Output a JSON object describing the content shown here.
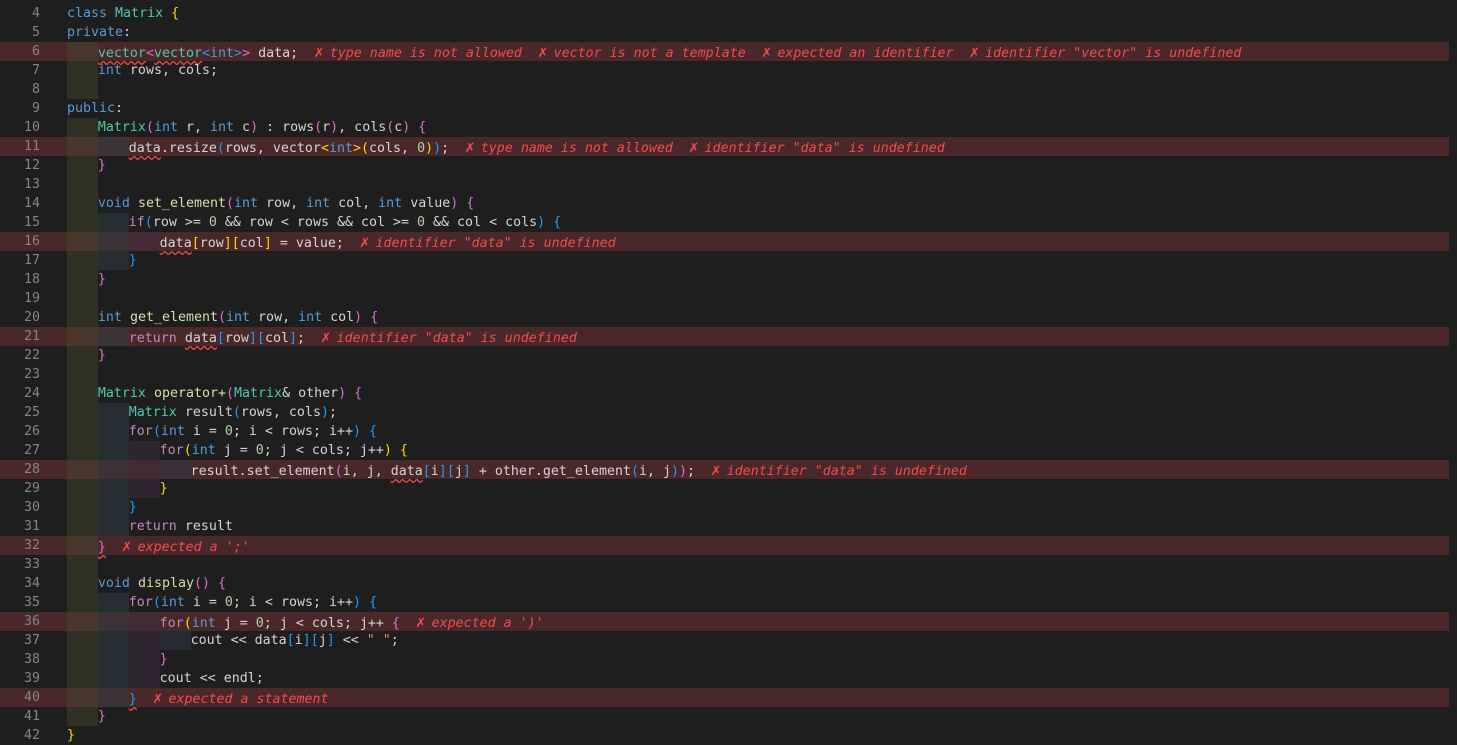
{
  "editor": {
    "colors": {
      "background": "#1e1e1e",
      "error_line": "#4a2829",
      "error_text": "#f14c4c"
    },
    "error_icon": "x-error-icon",
    "lines": [
      {
        "n": "4",
        "indent": 0,
        "tokens": [
          [
            "kw",
            "class"
          ],
          [
            "id",
            " "
          ],
          [
            "ty",
            "Matrix"
          ],
          [
            "id",
            " "
          ],
          [
            "b1",
            "{"
          ]
        ],
        "errors": []
      },
      {
        "n": "5",
        "indent": 0,
        "tokens": [
          [
            "kw",
            "private"
          ],
          [
            "id",
            ":"
          ]
        ],
        "errors": []
      },
      {
        "n": "6",
        "indent": 1,
        "tokens": [
          [
            "ty",
            "vector",
            1
          ],
          [
            "b2",
            "<"
          ],
          [
            "ty",
            "vector",
            1
          ],
          [
            "b3",
            "<"
          ],
          [
            "kw",
            "int"
          ],
          [
            "b3",
            ">"
          ],
          [
            "b2",
            ">"
          ],
          [
            "id",
            " data;"
          ]
        ],
        "errors": [
          "type name is not allowed",
          "vector is not a template",
          "expected an identifier",
          "identifier \"vector\" is undefined"
        ]
      },
      {
        "n": "7",
        "indent": 1,
        "tokens": [
          [
            "kw",
            "int"
          ],
          [
            "id",
            " rows, cols;"
          ]
        ],
        "errors": []
      },
      {
        "n": "8",
        "indent": 1,
        "tokens": [],
        "errors": []
      },
      {
        "n": "9",
        "indent": 0,
        "tokens": [
          [
            "kw",
            "public"
          ],
          [
            "id",
            ":"
          ]
        ],
        "errors": []
      },
      {
        "n": "10",
        "indent": 1,
        "tokens": [
          [
            "ty",
            "Matrix"
          ],
          [
            "b2",
            "("
          ],
          [
            "kw",
            "int"
          ],
          [
            "id",
            " r, "
          ],
          [
            "kw",
            "int"
          ],
          [
            "id",
            " c"
          ],
          [
            "b2",
            ")"
          ],
          [
            "id",
            " : rows"
          ],
          [
            "b2",
            "("
          ],
          [
            "id",
            "r"
          ],
          [
            "b2",
            ")"
          ],
          [
            "id",
            ", cols"
          ],
          [
            "b2",
            "("
          ],
          [
            "id",
            "c"
          ],
          [
            "b2",
            ")"
          ],
          [
            "id",
            " "
          ],
          [
            "b2",
            "{"
          ]
        ],
        "errors": []
      },
      {
        "n": "11",
        "indent": 2,
        "tokens": [
          [
            "id",
            "data",
            1
          ],
          [
            "id",
            ".resize"
          ],
          [
            "b3",
            "("
          ],
          [
            "id",
            "rows, vector"
          ],
          [
            "b1",
            "<"
          ],
          [
            "kw",
            "int"
          ],
          [
            "b1",
            ">"
          ],
          [
            "b1",
            "("
          ],
          [
            "id",
            "cols, "
          ],
          [
            "num",
            "0"
          ],
          [
            "b1",
            ")"
          ],
          [
            "b3",
            ")"
          ],
          [
            "id",
            ";"
          ]
        ],
        "errors": [
          "type name is not allowed",
          "identifier \"data\" is undefined"
        ]
      },
      {
        "n": "12",
        "indent": 1,
        "tokens": [
          [
            "b2",
            "}"
          ]
        ],
        "errors": []
      },
      {
        "n": "13",
        "indent": 1,
        "tokens": [],
        "errors": []
      },
      {
        "n": "14",
        "indent": 1,
        "tokens": [
          [
            "kw",
            "void"
          ],
          [
            "id",
            " "
          ],
          [
            "fn",
            "set_element"
          ],
          [
            "b2",
            "("
          ],
          [
            "kw",
            "int"
          ],
          [
            "id",
            " row, "
          ],
          [
            "kw",
            "int"
          ],
          [
            "id",
            " col, "
          ],
          [
            "kw",
            "int"
          ],
          [
            "id",
            " value"
          ],
          [
            "b2",
            ")"
          ],
          [
            "id",
            " "
          ],
          [
            "b2",
            "{"
          ]
        ],
        "errors": []
      },
      {
        "n": "15",
        "indent": 2,
        "tokens": [
          [
            "kw2",
            "if"
          ],
          [
            "b3",
            "("
          ],
          [
            "id",
            "row >= "
          ],
          [
            "num",
            "0"
          ],
          [
            "id",
            " && row < rows && col >= "
          ],
          [
            "num",
            "0"
          ],
          [
            "id",
            " && col < cols"
          ],
          [
            "b3",
            ")"
          ],
          [
            "id",
            " "
          ],
          [
            "b3",
            "{"
          ]
        ],
        "errors": []
      },
      {
        "n": "16",
        "indent": 3,
        "tokens": [
          [
            "id",
            "data",
            1
          ],
          [
            "b1",
            "["
          ],
          [
            "id",
            "row"
          ],
          [
            "b1",
            "]"
          ],
          [
            "b1",
            "["
          ],
          [
            "id",
            "col"
          ],
          [
            "b1",
            "]"
          ],
          [
            "id",
            " = value;"
          ]
        ],
        "errors": [
          "identifier \"data\" is undefined"
        ]
      },
      {
        "n": "17",
        "indent": 2,
        "tokens": [
          [
            "b3",
            "}"
          ]
        ],
        "errors": []
      },
      {
        "n": "18",
        "indent": 1,
        "tokens": [
          [
            "b2",
            "}"
          ]
        ],
        "errors": []
      },
      {
        "n": "19",
        "indent": 1,
        "tokens": [],
        "errors": []
      },
      {
        "n": "20",
        "indent": 1,
        "tokens": [
          [
            "kw",
            "int"
          ],
          [
            "id",
            " "
          ],
          [
            "fn",
            "get_element"
          ],
          [
            "b2",
            "("
          ],
          [
            "kw",
            "int"
          ],
          [
            "id",
            " row, "
          ],
          [
            "kw",
            "int"
          ],
          [
            "id",
            " col"
          ],
          [
            "b2",
            ")"
          ],
          [
            "id",
            " "
          ],
          [
            "b2",
            "{"
          ]
        ],
        "errors": []
      },
      {
        "n": "21",
        "indent": 2,
        "tokens": [
          [
            "kw2",
            "return"
          ],
          [
            "id",
            " "
          ],
          [
            "id",
            "data",
            1
          ],
          [
            "b3",
            "["
          ],
          [
            "id",
            "row"
          ],
          [
            "b3",
            "]"
          ],
          [
            "b3",
            "["
          ],
          [
            "id",
            "col"
          ],
          [
            "b3",
            "]"
          ],
          [
            "id",
            ";"
          ]
        ],
        "errors": [
          "identifier \"data\" is undefined"
        ]
      },
      {
        "n": "22",
        "indent": 1,
        "tokens": [
          [
            "b2",
            "}"
          ]
        ],
        "errors": []
      },
      {
        "n": "23",
        "indent": 1,
        "tokens": [],
        "errors": []
      },
      {
        "n": "24",
        "indent": 1,
        "tokens": [
          [
            "ty",
            "Matrix"
          ],
          [
            "id",
            " "
          ],
          [
            "fn",
            "operator+"
          ],
          [
            "b2",
            "("
          ],
          [
            "ty",
            "Matrix"
          ],
          [
            "id",
            "& other"
          ],
          [
            "b2",
            ")"
          ],
          [
            "id",
            " "
          ],
          [
            "b2",
            "{"
          ]
        ],
        "errors": []
      },
      {
        "n": "25",
        "indent": 2,
        "tokens": [
          [
            "ty",
            "Matrix"
          ],
          [
            "id",
            " result"
          ],
          [
            "b3",
            "("
          ],
          [
            "id",
            "rows, cols"
          ],
          [
            "b3",
            ")"
          ],
          [
            "id",
            ";"
          ]
        ],
        "errors": []
      },
      {
        "n": "26",
        "indent": 2,
        "tokens": [
          [
            "kw2",
            "for"
          ],
          [
            "b3",
            "("
          ],
          [
            "kw",
            "int"
          ],
          [
            "id",
            " i = "
          ],
          [
            "num",
            "0"
          ],
          [
            "id",
            "; i < rows; i++"
          ],
          [
            "b3",
            ")"
          ],
          [
            "id",
            " "
          ],
          [
            "b3",
            "{"
          ]
        ],
        "errors": []
      },
      {
        "n": "27",
        "indent": 3,
        "tokens": [
          [
            "kw2",
            "for"
          ],
          [
            "b1",
            "("
          ],
          [
            "kw",
            "int"
          ],
          [
            "id",
            " j = "
          ],
          [
            "num",
            "0"
          ],
          [
            "id",
            "; j < cols; j++"
          ],
          [
            "b1",
            ")"
          ],
          [
            "id",
            " "
          ],
          [
            "b1",
            "{"
          ]
        ],
        "errors": []
      },
      {
        "n": "28",
        "indent": 4,
        "tokens": [
          [
            "id",
            "result.set_element"
          ],
          [
            "b2",
            "("
          ],
          [
            "id",
            "i, j, "
          ],
          [
            "id",
            "data",
            1
          ],
          [
            "b3",
            "["
          ],
          [
            "id",
            "i"
          ],
          [
            "b3",
            "]"
          ],
          [
            "b3",
            "["
          ],
          [
            "id",
            "j"
          ],
          [
            "b3",
            "]"
          ],
          [
            "id",
            " + other.get_element"
          ],
          [
            "b3",
            "("
          ],
          [
            "id",
            "i, j"
          ],
          [
            "b3",
            ")"
          ],
          [
            "b2",
            ")"
          ],
          [
            "id",
            ";"
          ]
        ],
        "errors": [
          "identifier \"data\" is undefined"
        ]
      },
      {
        "n": "29",
        "indent": 3,
        "tokens": [
          [
            "b1",
            "}"
          ]
        ],
        "errors": []
      },
      {
        "n": "30",
        "indent": 2,
        "tokens": [
          [
            "b3",
            "}"
          ]
        ],
        "errors": []
      },
      {
        "n": "31",
        "indent": 2,
        "tokens": [
          [
            "kw2",
            "return"
          ],
          [
            "id",
            " result"
          ]
        ],
        "errors": []
      },
      {
        "n": "32",
        "indent": 1,
        "tokens": [
          [
            "b2",
            "}",
            1
          ]
        ],
        "errors": [
          "expected a ';'"
        ]
      },
      {
        "n": "33",
        "indent": 1,
        "tokens": [],
        "errors": []
      },
      {
        "n": "34",
        "indent": 1,
        "tokens": [
          [
            "kw",
            "void"
          ],
          [
            "id",
            " "
          ],
          [
            "fn",
            "display"
          ],
          [
            "b2",
            "()"
          ],
          [
            "id",
            " "
          ],
          [
            "b2",
            "{"
          ]
        ],
        "errors": []
      },
      {
        "n": "35",
        "indent": 2,
        "tokens": [
          [
            "kw2",
            "for"
          ],
          [
            "b3",
            "("
          ],
          [
            "kw",
            "int"
          ],
          [
            "id",
            " i = "
          ],
          [
            "num",
            "0"
          ],
          [
            "id",
            "; i < rows; i++"
          ],
          [
            "b3",
            ")"
          ],
          [
            "id",
            " "
          ],
          [
            "b3",
            "{"
          ]
        ],
        "errors": []
      },
      {
        "n": "36",
        "indent": 3,
        "tokens": [
          [
            "kw2",
            "for"
          ],
          [
            "b1",
            "("
          ],
          [
            "kw",
            "int"
          ],
          [
            "id",
            " j = "
          ],
          [
            "num",
            "0"
          ],
          [
            "id",
            "; j < cols; j++ "
          ],
          [
            "b2",
            "{"
          ]
        ],
        "errors": [
          "expected a ')'"
        ]
      },
      {
        "n": "37",
        "indent": 4,
        "tokens": [
          [
            "id",
            "cout << data"
          ],
          [
            "b3",
            "["
          ],
          [
            "id",
            "i"
          ],
          [
            "b3",
            "]"
          ],
          [
            "b3",
            "["
          ],
          [
            "id",
            "j"
          ],
          [
            "b3",
            "]"
          ],
          [
            "id",
            " << "
          ],
          [
            "str",
            "\" \""
          ],
          [
            "id",
            ";"
          ]
        ],
        "errors": []
      },
      {
        "n": "38",
        "indent": 3,
        "tokens": [
          [
            "b2",
            "}"
          ]
        ],
        "errors": []
      },
      {
        "n": "39",
        "indent": 3,
        "tokens": [
          [
            "id",
            "cout << endl;"
          ]
        ],
        "errors": []
      },
      {
        "n": "40",
        "indent": 2,
        "tokens": [
          [
            "b3",
            "}",
            1
          ]
        ],
        "errors": [
          "expected a statement"
        ]
      },
      {
        "n": "41",
        "indent": 1,
        "tokens": [
          [
            "b2",
            "}"
          ]
        ],
        "errors": []
      },
      {
        "n": "42",
        "indent": 0,
        "tokens": [
          [
            "b1",
            "}"
          ]
        ],
        "errors": []
      }
    ]
  }
}
